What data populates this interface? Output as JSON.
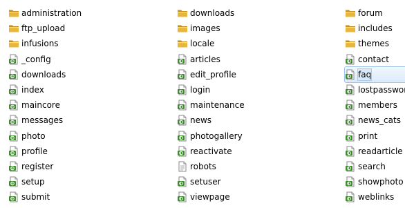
{
  "columns": [
    [
      {
        "label": "administration",
        "icon": "folder-icon"
      },
      {
        "label": "ftp_upload",
        "icon": "folder-icon"
      },
      {
        "label": "infusions",
        "icon": "folder-icon"
      },
      {
        "label": "_config",
        "icon": "php-file-icon"
      },
      {
        "label": "downloads",
        "icon": "php-file-icon"
      },
      {
        "label": "index",
        "icon": "php-file-icon"
      },
      {
        "label": "maincore",
        "icon": "php-file-icon"
      },
      {
        "label": "messages",
        "icon": "php-file-icon"
      },
      {
        "label": "photo",
        "icon": "php-file-icon"
      },
      {
        "label": "profile",
        "icon": "php-file-icon"
      },
      {
        "label": "register",
        "icon": "php-file-icon"
      },
      {
        "label": "setup",
        "icon": "php-file-icon"
      },
      {
        "label": "submit",
        "icon": "php-file-icon"
      }
    ],
    [
      {
        "label": "downloads",
        "icon": "folder-icon"
      },
      {
        "label": "images",
        "icon": "folder-icon"
      },
      {
        "label": "locale",
        "icon": "folder-icon"
      },
      {
        "label": "articles",
        "icon": "php-file-icon"
      },
      {
        "label": "edit_profile",
        "icon": "php-file-icon"
      },
      {
        "label": "login",
        "icon": "php-file-icon"
      },
      {
        "label": "maintenance",
        "icon": "php-file-icon"
      },
      {
        "label": "news",
        "icon": "php-file-icon"
      },
      {
        "label": "photogallery",
        "icon": "php-file-icon"
      },
      {
        "label": "reactivate",
        "icon": "php-file-icon"
      },
      {
        "label": "robots",
        "icon": "text-file-icon"
      },
      {
        "label": "setuser",
        "icon": "php-file-icon"
      },
      {
        "label": "viewpage",
        "icon": "php-file-icon"
      }
    ],
    [
      {
        "label": "forum",
        "icon": "folder-icon"
      },
      {
        "label": "includes",
        "icon": "folder-icon"
      },
      {
        "label": "themes",
        "icon": "folder-icon"
      },
      {
        "label": "contact",
        "icon": "php-file-icon"
      },
      {
        "label": "faq",
        "icon": "php-file-icon",
        "selected": true
      },
      {
        "label": "lostpassword",
        "icon": "php-file-icon"
      },
      {
        "label": "members",
        "icon": "php-file-icon"
      },
      {
        "label": "news_cats",
        "icon": "php-file-icon"
      },
      {
        "label": "print",
        "icon": "php-file-icon"
      },
      {
        "label": "readarticle",
        "icon": "php-file-icon"
      },
      {
        "label": "search",
        "icon": "php-file-icon"
      },
      {
        "label": "showphoto",
        "icon": "php-file-icon"
      },
      {
        "label": "weblinks",
        "icon": "php-file-icon"
      }
    ]
  ],
  "colors": {
    "folder": "#e8b63a",
    "folder_dark": "#c78f1c",
    "php_green": "#3f8a2f",
    "selection": "#dbeafa"
  }
}
